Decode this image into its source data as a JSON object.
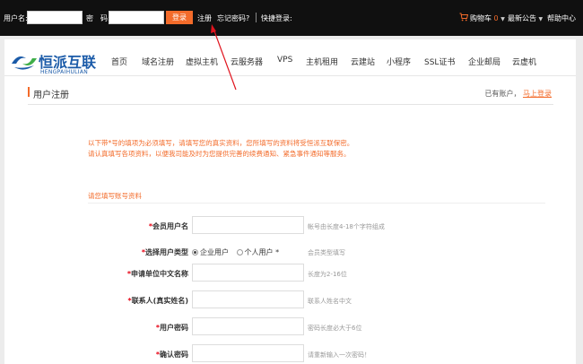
{
  "topbar": {
    "username_label": "用户名:",
    "password_label": "密　码:",
    "username_value": "",
    "password_value": "",
    "login_button": "登录",
    "register_link": "注册",
    "forgot_link": "忘记密码?",
    "quick_login": "快捷登录:",
    "cart_label": "购物车",
    "cart_count": "0",
    "announcements": "最新公告",
    "help": "帮助中心"
  },
  "brand": {
    "name": "恒派互联",
    "sub": "HENGPAIHULIAN",
    "color": "#1a5aa8",
    "accent": "#f36b2a"
  },
  "nav": {
    "items": [
      "首页",
      "域名注册",
      "虚拟主机",
      "云服务器",
      "VPS",
      "主机租用",
      "云建站",
      "小程序",
      "SSL证书",
      "企业邮局",
      "云虚机"
    ]
  },
  "page": {
    "title": "用户注册",
    "has_account": "已有账户，",
    "login_now": "马上登录"
  },
  "notice": {
    "line1": "以下带*号的填项为必须填写，请填写您的真实资料，您所填写的资料将受恒派互联保密。",
    "line2": "请认真填写各项资料，以便我司能及时为您提供完善的续费通知、紧急事件通知等服务。"
  },
  "section": {
    "title": "请您填写账号资料"
  },
  "form": {
    "username": {
      "label": "会员用户名",
      "hint": "帐号由长度4-18个字符组成",
      "value": ""
    },
    "type": {
      "label": "选择用户类型",
      "opt1": "企业用户",
      "opt2": "个人用户 *",
      "hint": "会员类型填写"
    },
    "company": {
      "label": "申请单位中文名称",
      "hint": "长度为2-16位",
      "value": ""
    },
    "contact": {
      "label": "联系人(真实姓名)",
      "hint": "联系人姓名中文",
      "value": ""
    },
    "password": {
      "label": "用户密码",
      "hint": "密码长度必大于6位",
      "value": ""
    },
    "confirm": {
      "label": "确认密码",
      "hint": "请重新输入一次密码！",
      "value": ""
    }
  }
}
